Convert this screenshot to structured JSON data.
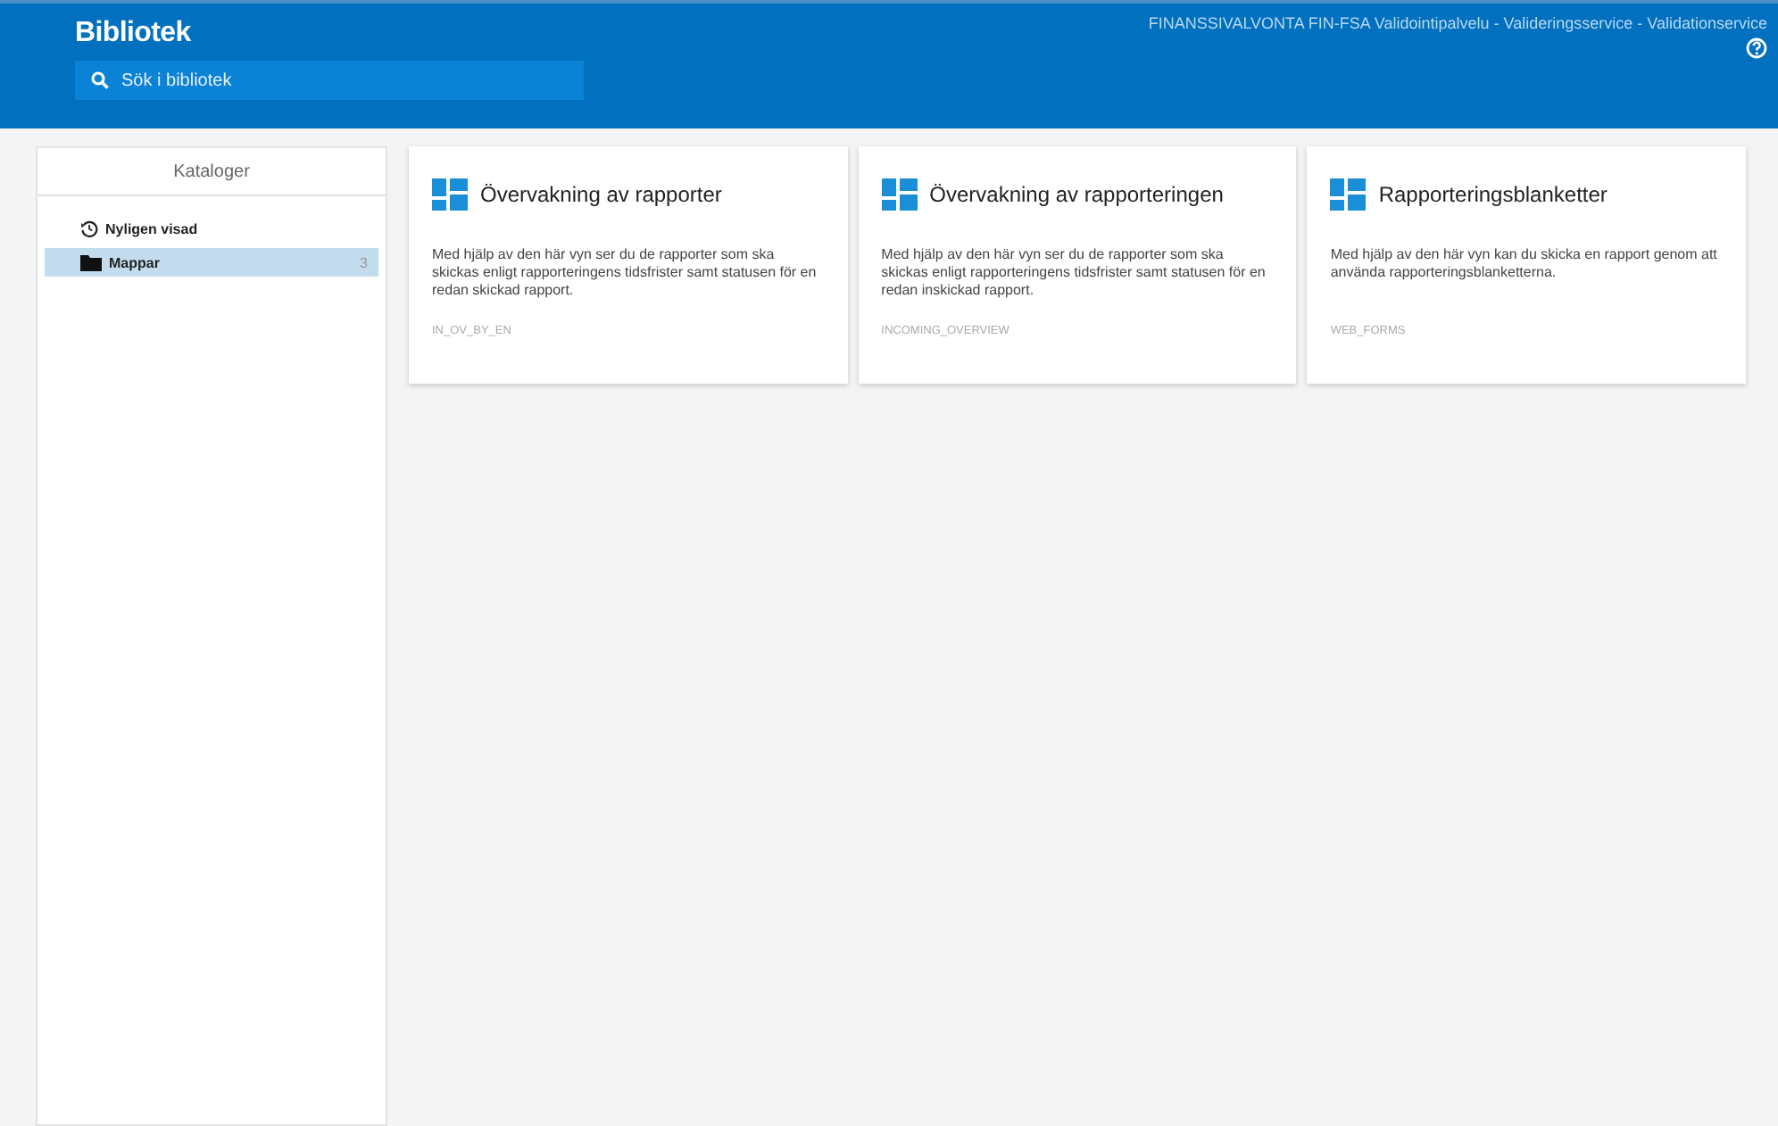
{
  "header": {
    "title": "Bibliotek",
    "search": {
      "placeholder": "Sök i bibliotek"
    },
    "service_name": "FINANSSIVALVONTA FIN-FSA Validointipalvelu - Valideringsservice - Validationservice"
  },
  "sidebar": {
    "title": "Kataloger",
    "items": [
      {
        "label": "Nyligen visad",
        "kind": "history",
        "selected": false
      },
      {
        "label": "Mappar",
        "kind": "folder",
        "selected": true,
        "count": "3"
      }
    ]
  },
  "cards": [
    {
      "title": "Övervakning av rapporter",
      "description": "Med hjälp av den här vyn ser du de rapporter som ska skickas enligt rapporteringens tidsfrister samt statusen för en redan skickad rapport.",
      "code": "IN_OV_BY_EN"
    },
    {
      "title": "Övervakning av rapporteringen",
      "description": "Med hjälp av den här vyn ser du de rapporter som ska skickas enligt rapporteringens tidsfrister samt statusen för en redan inskickad rapport.",
      "code": "INCOMING_OVERVIEW"
    },
    {
      "title": "Rapporteringsblanketter",
      "description": "Med hjälp av den här vyn kan du skicka en rapport genom att använda rapporteringsblanketterna.",
      "code": "WEB_FORMS"
    }
  ]
}
